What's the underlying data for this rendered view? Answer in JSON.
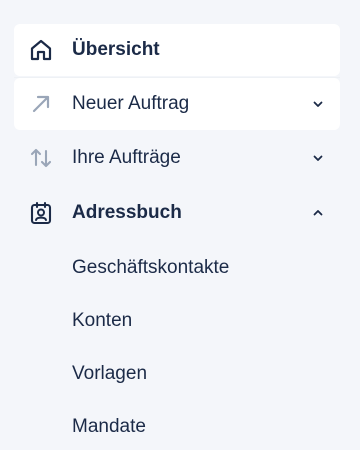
{
  "nav": {
    "items": [
      {
        "label": "Übersicht",
        "icon": "home-icon",
        "bold": true
      },
      {
        "label": "Neuer Auftrag",
        "icon": "arrow-up-right-icon",
        "chevron": "down"
      },
      {
        "label": "Ihre Aufträge",
        "icon": "arrows-up-down-icon",
        "chevron": "down"
      },
      {
        "label": "Adressbuch",
        "icon": "contact-card-icon",
        "bold": true,
        "chevron": "up"
      }
    ],
    "subitems": [
      {
        "label": "Geschäftskontakte"
      },
      {
        "label": "Konten"
      },
      {
        "label": "Vorlagen"
      },
      {
        "label": "Mandate"
      }
    ]
  },
  "colors": {
    "text": "#1b2a47",
    "muted_icon": "#9aa6b8",
    "background": "#f4f6fa",
    "card": "#ffffff"
  }
}
